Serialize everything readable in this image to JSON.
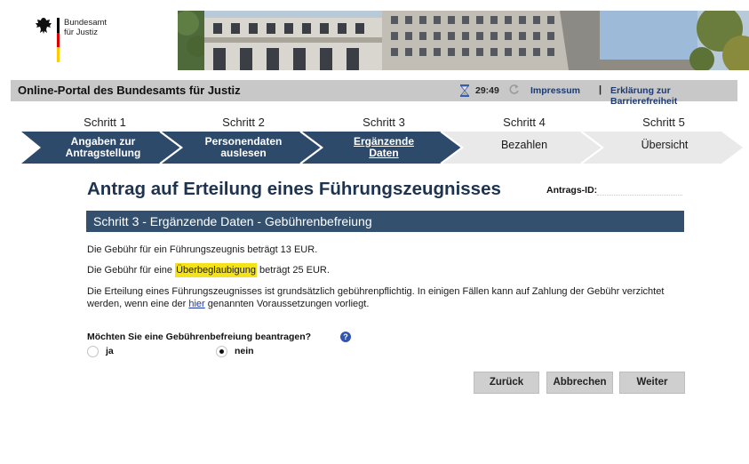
{
  "header": {
    "org_line1": "Bundesamt",
    "org_line2": "für Justiz",
    "flag_colors": [
      "#000000",
      "#dd0000",
      "#ffcc00"
    ]
  },
  "titlebar": {
    "portal_title": "Online-Portal des Bundesamts für Justiz",
    "timer": "29:49",
    "impressum": "Impressum",
    "separator": "|",
    "barrierefreiheit": "Erklärung zur Barrierefreiheit"
  },
  "steps": [
    {
      "number": "Schritt 1",
      "label_line1": "Angaben zur",
      "label_line2": "Antragstellung",
      "state": "done"
    },
    {
      "number": "Schritt 2",
      "label_line1": "Personendaten",
      "label_line2": "auslesen",
      "state": "done"
    },
    {
      "number": "Schritt 3",
      "label_line1": "Ergänzende",
      "label_line2": "Daten",
      "state": "active"
    },
    {
      "number": "Schritt 4",
      "label_line1": "Bezahlen",
      "label_line2": "",
      "state": "todo"
    },
    {
      "number": "Schritt 5",
      "label_line1": "Übersicht",
      "label_line2": "",
      "state": "todo"
    }
  ],
  "main": {
    "title": "Antrag auf Erteilung eines Führungszeugnisses",
    "antrags_id_label": "Antrags-ID:",
    "antrags_id_value": "",
    "section_title": "Schritt 3 - Ergänzende Daten - Gebührenbefreiung",
    "fee_text": "Die Gebühr für ein Führungszeugnis beträgt 13 EUR.",
    "fee2_before": "Die Gebühr für eine ",
    "fee2_highlight": "Überbeglaubigung",
    "fee2_after": " beträgt 25 EUR.",
    "info_line1": "Die Erteilung eines Führungszeugnisses ist grundsätzlich gebührenpflichtig. In einigen Fällen kann auf Zahlung der Gebühr verzichtet",
    "info_line2_before": "werden, wenn eine der ",
    "info_link": "hier",
    "info_line2_after": " genannten Voraussetzungen vorliegt.",
    "question": "Möchten Sie eine Gebührenbefreiung beantragen?",
    "help_symbol": "?",
    "option_yes": "ja",
    "option_no": "nein",
    "selected_option": "nein"
  },
  "buttons": {
    "back": "Zurück",
    "cancel": "Abbrechen",
    "next": "Weiter"
  },
  "colors": {
    "step_dark": "#2e4a6b",
    "step_light": "#e9e9e9",
    "section_bar": "#34506f",
    "title": "#1d3350",
    "highlight": "#f4e21a"
  }
}
